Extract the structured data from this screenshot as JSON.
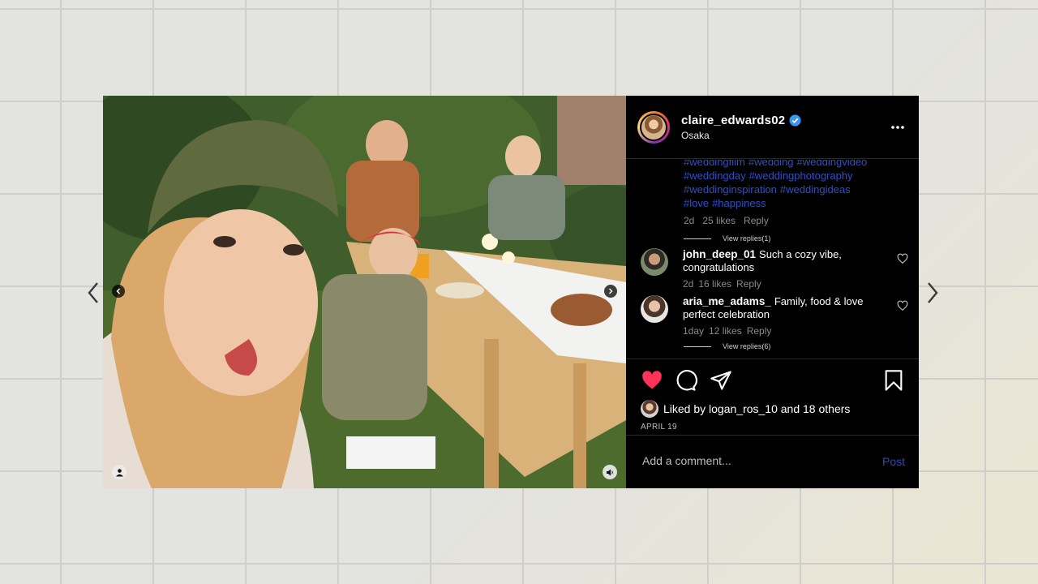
{
  "navigation": {
    "prev_icon": "chevron-left-icon",
    "next_icon": "chevron-right-icon"
  },
  "post": {
    "username": "claire_edwards02",
    "location": "Osaka",
    "verified": true,
    "hashtags": [
      "#weddingfilm",
      "#wedding",
      "#weddingvideo",
      "#weddingday",
      "#weddingphotography",
      "#weddinginspiration",
      "#weddingideas",
      "#love",
      "#happiness"
    ],
    "caption_meta": {
      "age": "2d",
      "likes": "25 likes",
      "reply": "Reply",
      "view_replies": "View replies(1)"
    },
    "comments": [
      {
        "username": "john_deep_01",
        "text": "Such a cozy vibe, congratulations",
        "age": "2d",
        "likes": "16 likes",
        "reply": "Reply"
      },
      {
        "username": "aria_me_adams_",
        "text": "Family, food & love perfect celebration",
        "age": "1day",
        "likes": "12 likes",
        "reply": "Reply",
        "view_replies": "View replies(6)"
      }
    ],
    "liked_by": "Liked by logan_ros_10 and 18 others",
    "date": "APRIL 19",
    "add_comment_placeholder": "Add a comment...",
    "post_label": "Post",
    "liked": true
  },
  "colors": {
    "heart": "#ff3358",
    "link": "#2f4fc7",
    "verified": "#3897f0"
  }
}
